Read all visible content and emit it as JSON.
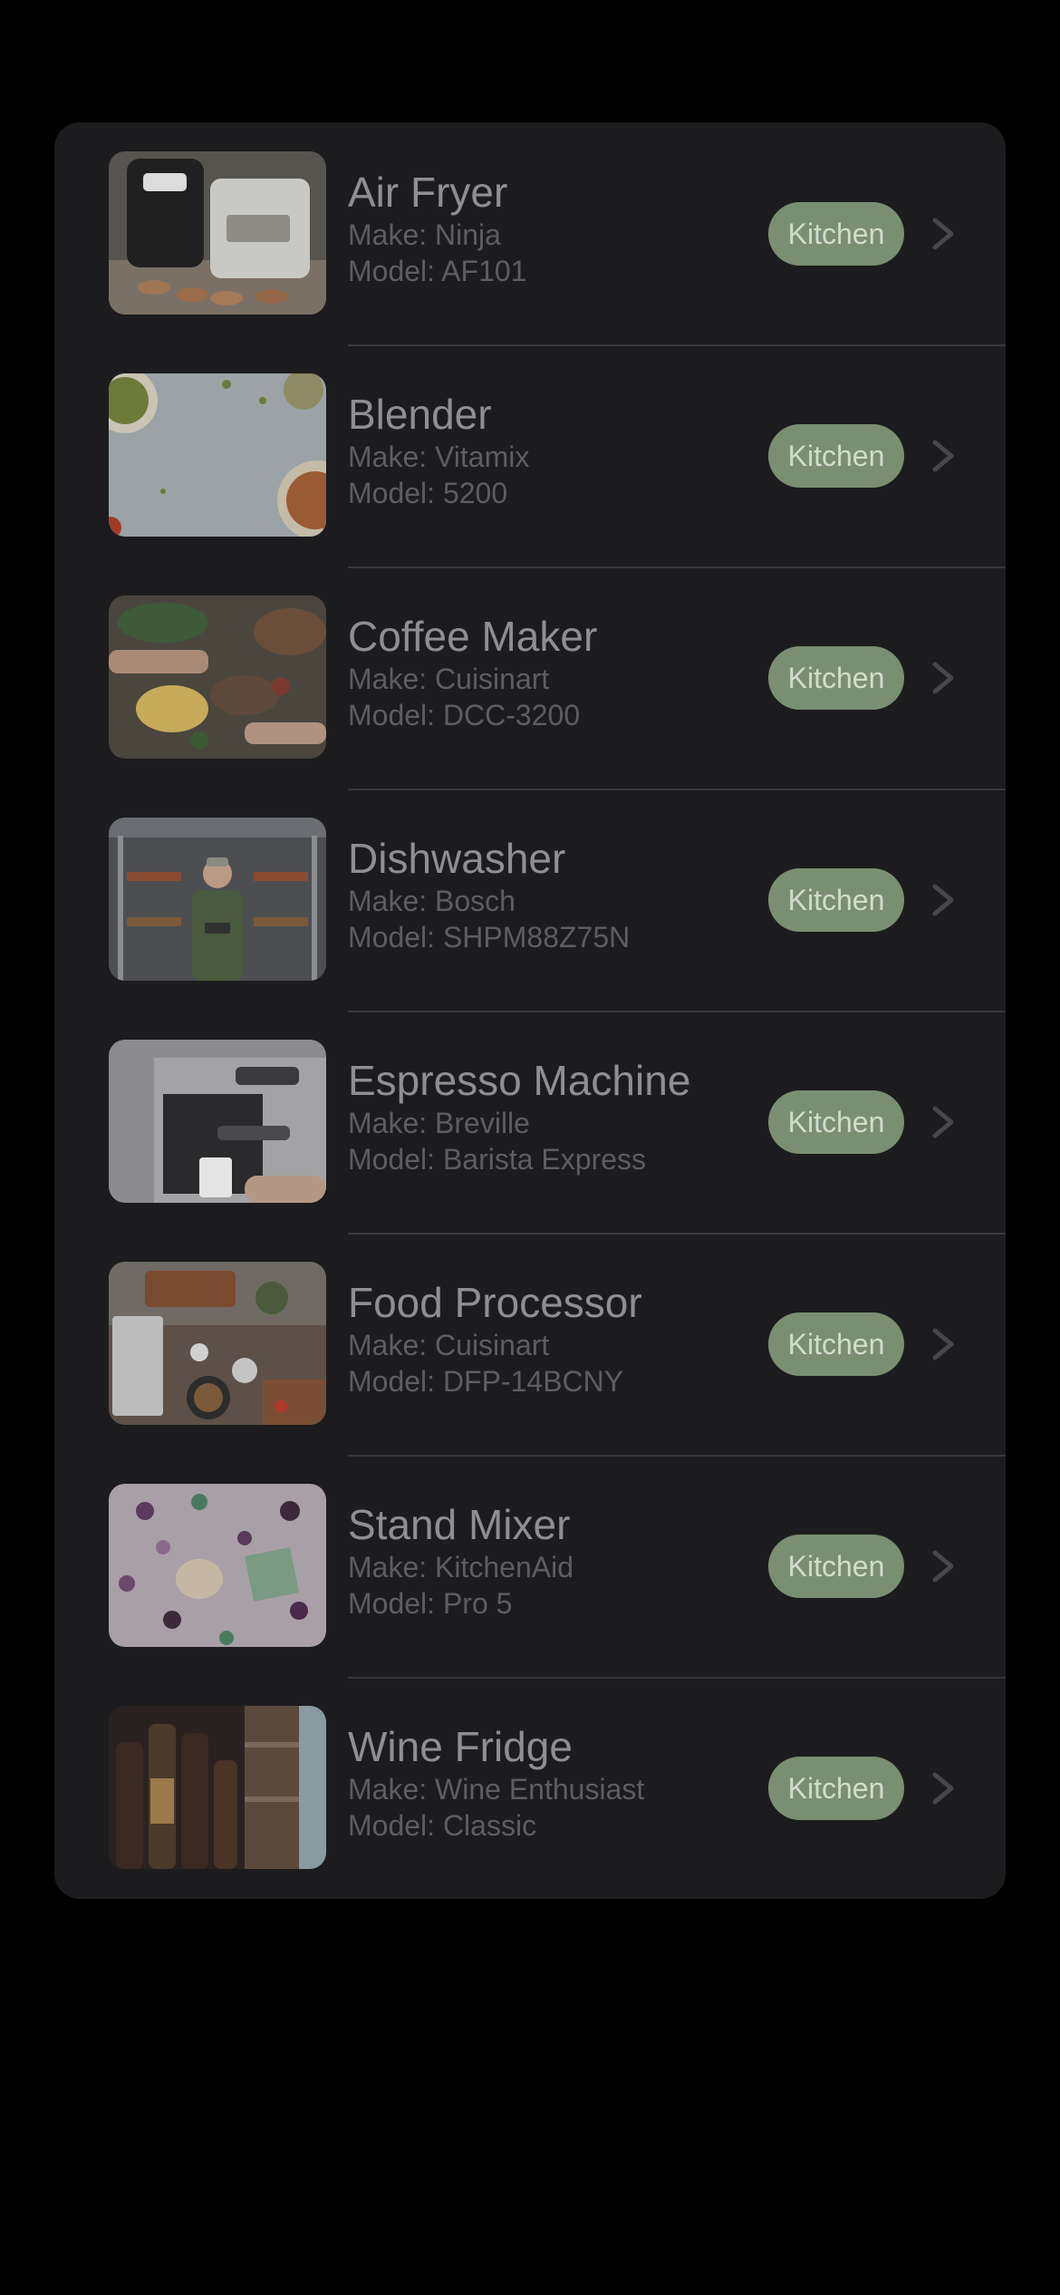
{
  "items": [
    {
      "name": "Air Fryer",
      "make": "Make: Ninja",
      "model": "Model: AF101",
      "tag": "Kitchen",
      "image": "air-fryer-photo"
    },
    {
      "name": "Blender",
      "make": "Make: Vitamix",
      "model": "Model: 5200",
      "tag": "Kitchen",
      "image": "blender-photo"
    },
    {
      "name": "Coffee Maker",
      "make": "Make: Cuisinart",
      "model": "Model: DCC-3200",
      "tag": "Kitchen",
      "image": "coffee-maker-photo"
    },
    {
      "name": "Dishwasher",
      "make": "Make: Bosch",
      "model": "Model: SHPM88Z75N",
      "tag": "Kitchen",
      "image": "dishwasher-photo"
    },
    {
      "name": "Espresso Machine",
      "make": "Make: Breville",
      "model": "Model: Barista Express",
      "tag": "Kitchen",
      "image": "espresso-machine-photo"
    },
    {
      "name": "Food Processor",
      "make": "Make: Cuisinart",
      "model": "Model: DFP-14BCNY",
      "tag": "Kitchen",
      "image": "food-processor-photo"
    },
    {
      "name": "Stand Mixer",
      "make": "Make: KitchenAid",
      "model": "Model: Pro 5",
      "tag": "Kitchen",
      "image": "stand-mixer-photo"
    },
    {
      "name": "Wine Fridge",
      "make": "Make: Wine Enthusiast",
      "model": "Model: Classic",
      "tag": "Kitchen",
      "image": "wine-fridge-photo"
    }
  ],
  "colors": {
    "background": "#000000",
    "card": "#1c1c1e",
    "title_text": "#8e8e93",
    "secondary_text": "#5d5d62",
    "badge_bg": "#7a8f72",
    "badge_text": "#d3dccc",
    "chevron": "#48484a"
  }
}
